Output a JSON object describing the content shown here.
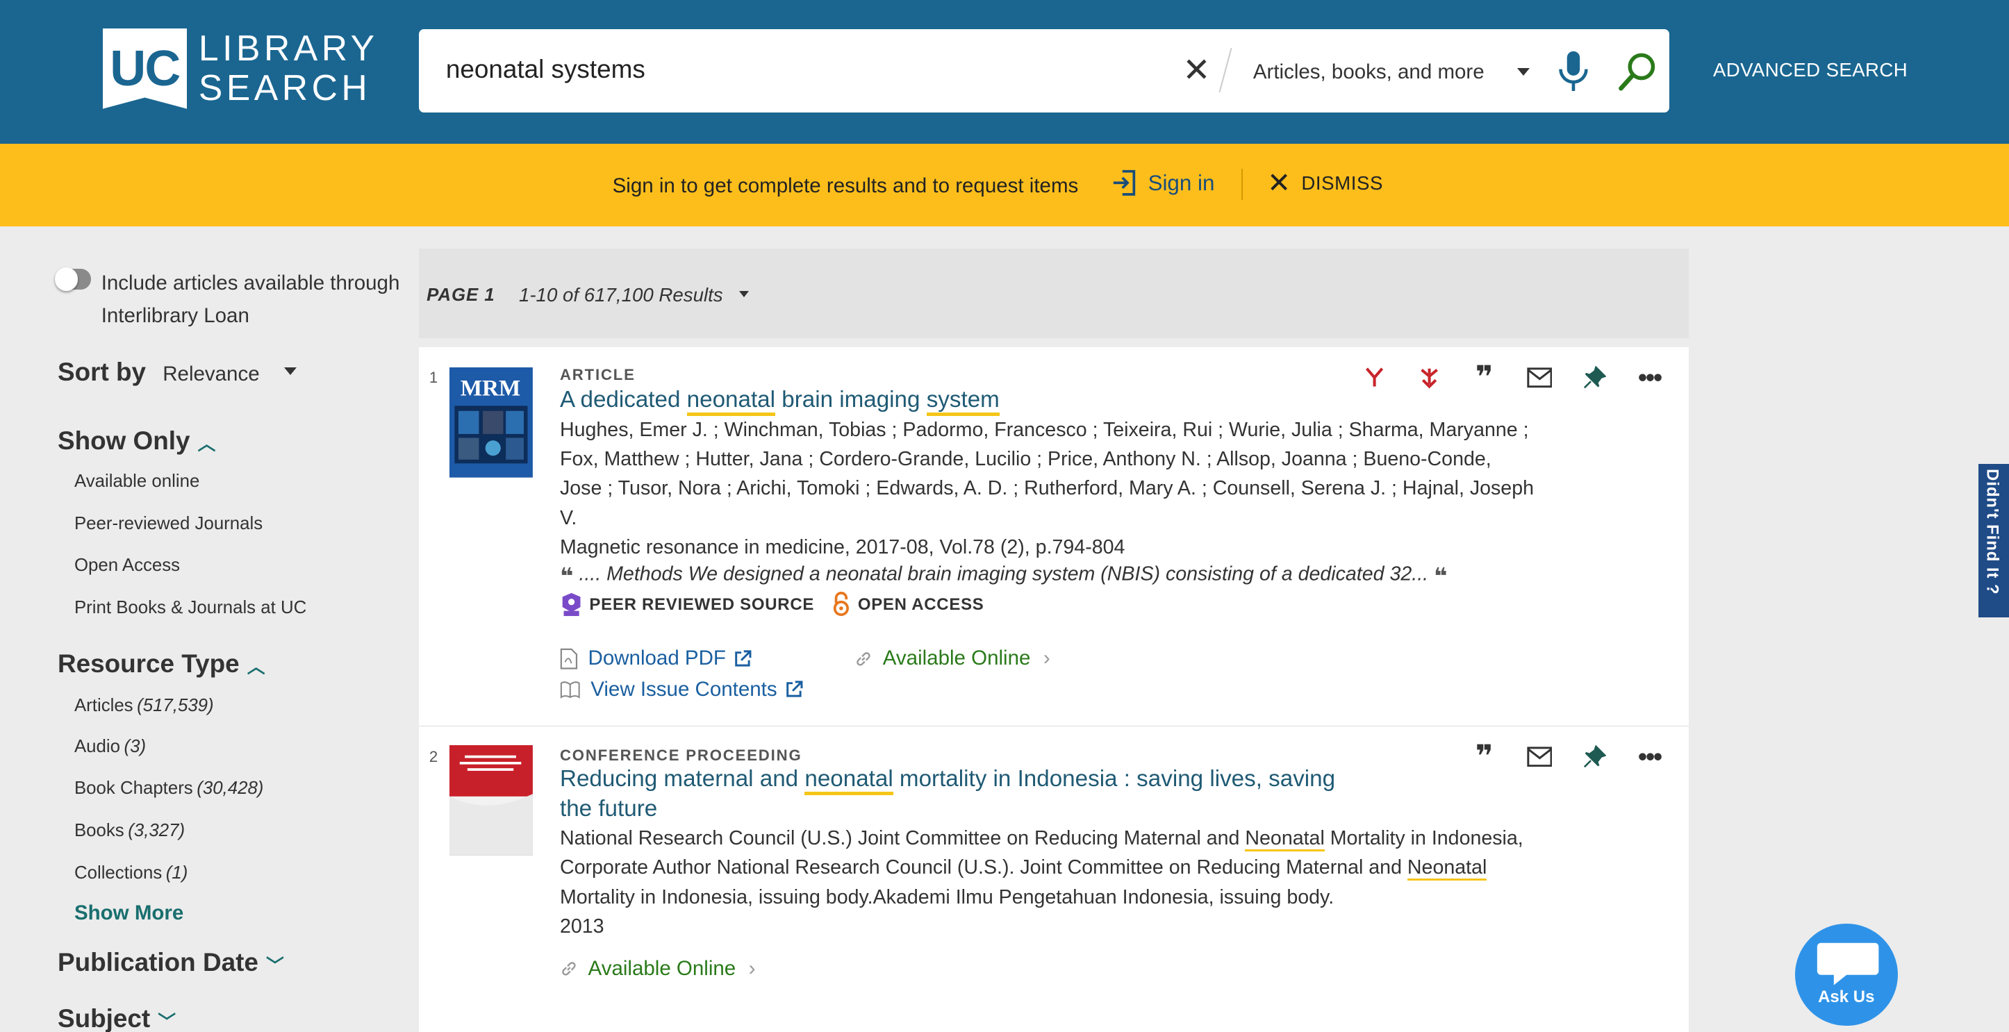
{
  "header": {
    "logo_uc": "UC",
    "logo_line1": "LIBRARY",
    "logo_line2": "SEARCH",
    "search_value": "neonatal systems",
    "scope_label": "Articles, books, and more",
    "advanced_search": "ADVANCED SEARCH",
    "colors": {
      "header_bg": "#1a6691",
      "banner_bg": "#fdbe1c"
    }
  },
  "banner": {
    "message": "Sign in to get complete results and to request items",
    "signin_label": "Sign in",
    "dismiss_label": "DISMISS"
  },
  "sidebar": {
    "ill_toggle_label": "Include articles available through Interlibrary Loan",
    "ill_toggle_on": false,
    "sort_by_label": "Sort by",
    "sort_value": "Relevance",
    "show_only": {
      "heading": "Show Only",
      "items": [
        "Available online",
        "Peer-reviewed Journals",
        "Open Access",
        "Print Books & Journals at UC"
      ]
    },
    "resource_type": {
      "heading": "Resource Type",
      "items": [
        {
          "label": "Articles",
          "count": "(517,539)"
        },
        {
          "label": "Audio",
          "count": "(3)"
        },
        {
          "label": "Book Chapters",
          "count": "(30,428)"
        },
        {
          "label": "Books",
          "count": "(3,327)"
        },
        {
          "label": "Collections",
          "count": "(1)"
        }
      ],
      "show_more": "Show More"
    },
    "publication_date_heading": "Publication Date",
    "subject_heading": "Subject"
  },
  "results_bar": {
    "page_label": "PAGE 1",
    "results_count": "1-10 of 617,100 Results"
  },
  "results": [
    {
      "number": "1",
      "type": "ARTICLE",
      "thumb_label": "MRM",
      "title_parts": [
        "A dedicated ",
        "neonatal",
        " brain imaging ",
        "system"
      ],
      "authors_lines": [
        "Hughes, Emer J. ; Winchman, Tobias ; Padormo, Francesco ; Teixeira, Rui ; Wurie, Julia ; Sharma, Maryanne ;",
        "Fox, Matthew ; Hutter, Jana ; Cordero-Grande, Lucilio ; Price, Anthony N. ; Allsop, Joanna ; Bueno-Conde,",
        "Jose ; Tusor, Nora ; Arichi, Tomoki ; Edwards, A. D. ; Rutherford, Mary A. ; Counsell, Serena J. ; Hajnal, Joseph",
        "V."
      ],
      "source": "Magnetic resonance in medicine, 2017-08, Vol.78 (2), p.794-804",
      "snippet": ".... Methods We designed a neonatal brain imaging system (NBIS) consisting of a dedicated 32...",
      "badge_peer": "PEER REVIEWED SOURCE",
      "badge_oa": "OPEN ACCESS",
      "download_pdf": "Download PDF",
      "available_online": "Available Online",
      "view_issue": "View Issue Contents"
    },
    {
      "number": "2",
      "type": "CONFERENCE PROCEEDING",
      "title_parts": [
        "Reducing maternal and ",
        "neonatal",
        " mortality in Indonesia : saving lives, saving",
        "the future"
      ],
      "authors_parts": [
        "National Research Council (U.S.) Joint Committee on Reducing Maternal and ",
        "Neonatal",
        " Mortality in Indonesia,",
        "Corporate Author National Research Council (U.S.). Joint Committee on Reducing Maternal and ",
        "Neonatal",
        "Mortality in Indonesia, issuing body.Akademi Ilmu Pengetahuan Indonesia, issuing body."
      ],
      "year": "2013",
      "available_online": "Available Online"
    }
  ],
  "widgets": {
    "didnt_find": "Didn't Find It ?",
    "ask_us": "Ask Us"
  }
}
